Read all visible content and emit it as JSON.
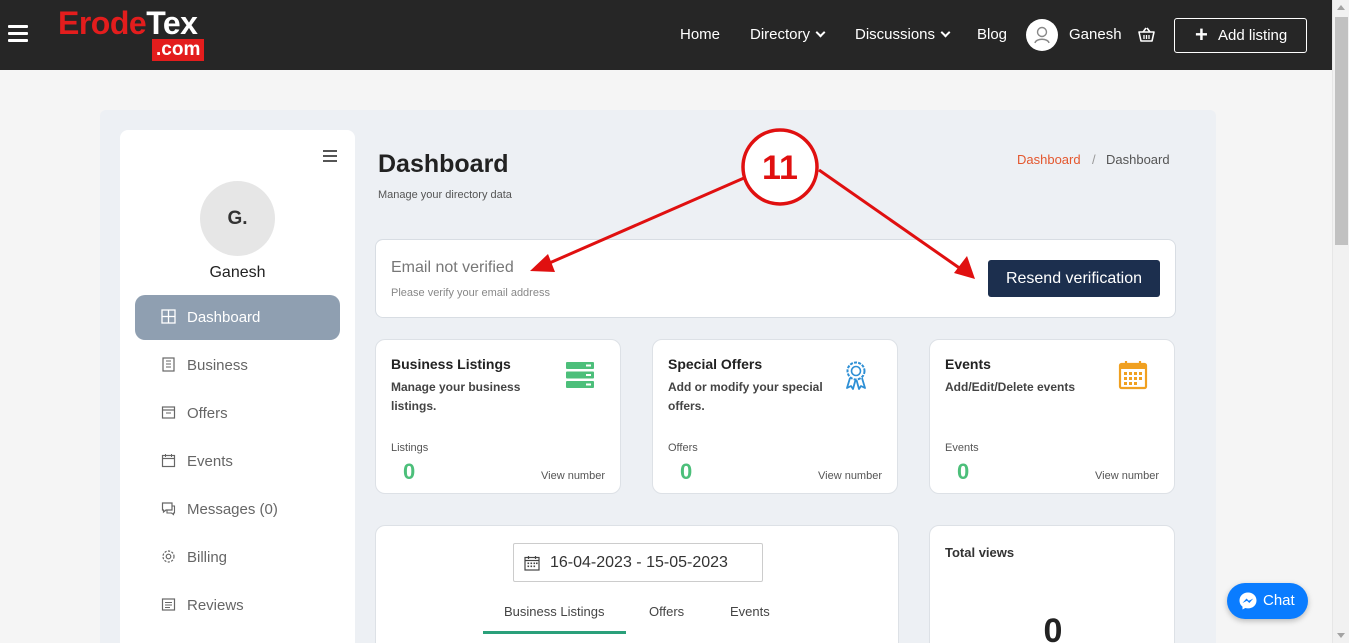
{
  "site": {
    "logo_main_red": "Erode",
    "logo_main_white": "Tex",
    "logo_sub": ".com"
  },
  "nav": {
    "home": "Home",
    "directory": "Directory",
    "discussions": "Discussions",
    "blog": "Blog",
    "user_name": "Ganesh",
    "add_listing": "Add listing"
  },
  "sidebar": {
    "initials": "G.",
    "name": "Ganesh",
    "items": [
      {
        "label": "Dashboard",
        "icon": "grid-icon"
      },
      {
        "label": "Business",
        "icon": "building-icon"
      },
      {
        "label": "Offers",
        "icon": "offer-box-icon"
      },
      {
        "label": "Events",
        "icon": "calendar-icon"
      },
      {
        "label": "Messages (0)",
        "icon": "messages-icon"
      },
      {
        "label": "Billing",
        "icon": "gear-icon"
      },
      {
        "label": "Reviews",
        "icon": "reviews-icon"
      }
    ]
  },
  "header": {
    "title": "Dashboard",
    "subtitle": "Manage your directory data",
    "breadcrumb": [
      "Dashboard",
      "/",
      "Dashboard"
    ]
  },
  "verify": {
    "title": "Email not verified",
    "subtitle": "Please verify your email address",
    "button": "Resend verification"
  },
  "cards": [
    {
      "title": "Business Listings",
      "desc": "Manage your business listings.",
      "label": "Listings",
      "value": "0",
      "link": "View number",
      "icon": "server-icon",
      "color": "#4cbf7a"
    },
    {
      "title": "Special Offers",
      "desc": "Add or modify your special offers.",
      "label": "Offers",
      "value": "0",
      "link": "View number",
      "icon": "award-ribbon-icon",
      "color": "#2d8fd5"
    },
    {
      "title": "Events",
      "desc": "Add/Edit/Delete events",
      "label": "Events",
      "value": "0",
      "link": "View number",
      "icon": "calendar-icon",
      "color": "#f0a020"
    }
  ],
  "chart_panel": {
    "date_range": "16-04-2023 - 15-05-2023",
    "tabs": [
      "Business Listings",
      "Offers",
      "Events"
    ],
    "active_tab": "Business Listings"
  },
  "total_views": {
    "title": "Total views",
    "value": "0"
  },
  "annotation": {
    "number": "11",
    "color": "#e01010"
  },
  "chat": {
    "label": "Chat"
  },
  "colors": {
    "topbar": "#262626",
    "brand_red": "#e31d1d",
    "button_navy": "#1c2f4e",
    "active_menu": "#8f9fb1",
    "stat_green": "#4cbf7a",
    "breadcrumb_link": "#e4572e"
  }
}
